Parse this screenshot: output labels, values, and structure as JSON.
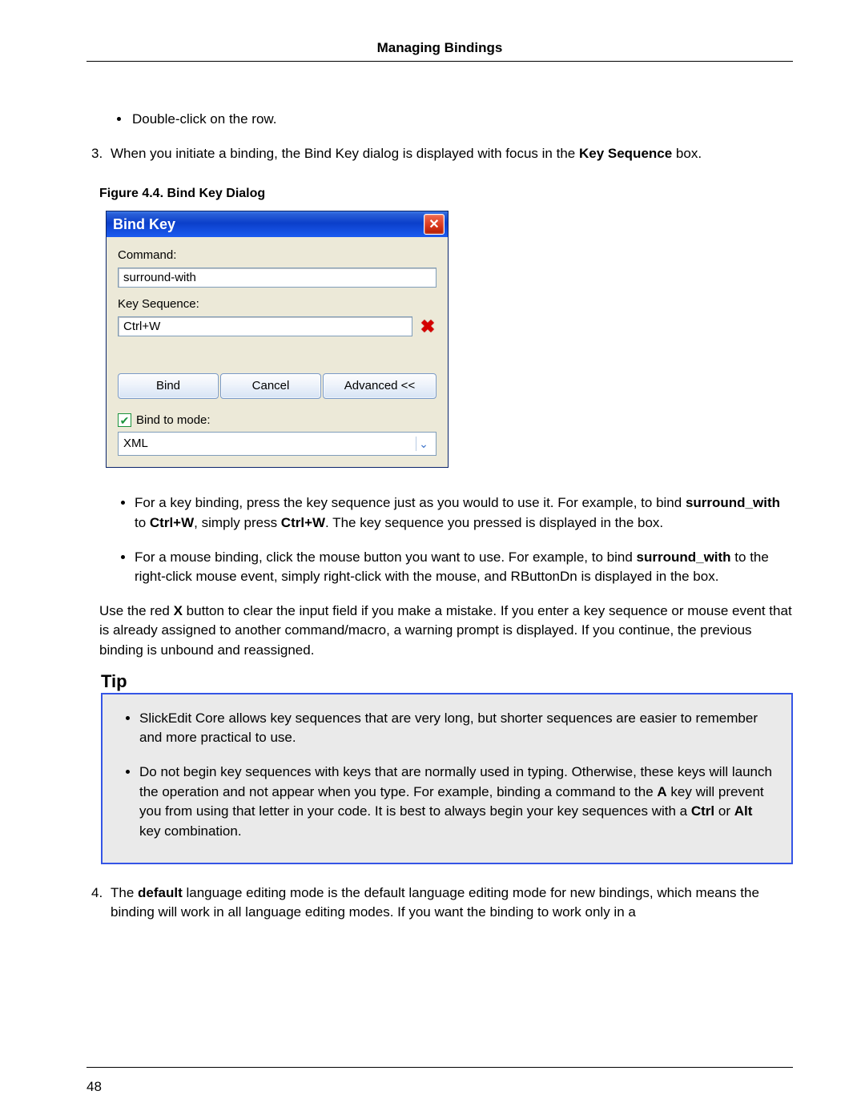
{
  "header": {
    "title": "Managing Bindings"
  },
  "page_number": "48",
  "bullets_top": [
    "Double-click on the row."
  ],
  "step3": {
    "num": "3.",
    "pre": "When you initiate a binding, the Bind Key dialog is displayed with focus in the ",
    "bold": "Key Sequence",
    "post": " box."
  },
  "figure_caption": "Figure 4.4.  Bind Key Dialog",
  "dialog": {
    "title": "Bind Key",
    "command_label": "Command:",
    "command_value": "surround-with",
    "keyseq_label": "Key Sequence:",
    "keyseq_value": "Ctrl+W",
    "btn_bind": "Bind",
    "btn_cancel": "Cancel",
    "btn_advanced": "Advanced <<",
    "bind_mode_label": "Bind to mode:",
    "bind_mode_value": "XML"
  },
  "after_fig": {
    "b1_pre": "For a key binding, press the key sequence just as you would to use it. For example, to bind ",
    "b1_bold1": "surround_with",
    "b1_mid": " to ",
    "b1_bold2": "Ctrl+W",
    "b1_mid2": ", simply press ",
    "b1_bold3": "Ctrl+W",
    "b1_post": ". The key sequence you pressed is displayed in the box.",
    "b2_pre": "For a mouse binding, click the mouse button you want to use. For example, to bind ",
    "b2_bold": "surround_with",
    "b2_post": " to the right-click mouse event, simply right-click with the mouse, and RButtonDn is displayed in the box."
  },
  "red_x_para": {
    "pre": "Use the red ",
    "bold": "X",
    "post": " button to clear the input field if you make a mistake. If you enter a key sequence or mouse event that is already assigned to another command/macro, a warning prompt is displayed. If you continue, the previous binding is unbound and reassigned."
  },
  "tip": {
    "title": "Tip",
    "t1": "SlickEdit Core allows key sequences that are very long, but shorter sequences are easier to remember and more practical to use.",
    "t2_pre": "Do not begin key sequences with keys that are normally used in typing. Otherwise, these keys will launch the operation and not appear when you type. For example, binding a command to the ",
    "t2_boldA": "A",
    "t2_mid": " key will prevent you from using that letter in your code. It is best to always begin your key sequences with a ",
    "t2_boldCtrl": "Ctrl",
    "t2_or": " or ",
    "t2_boldAlt": "Alt",
    "t2_end": " key combination."
  },
  "step4": {
    "num": "4.",
    "pre": "The ",
    "bold": "default",
    "post": " language editing mode is the default language editing mode for new bindings, which means the binding will work in all language editing modes. If you want the binding to work only in a"
  }
}
